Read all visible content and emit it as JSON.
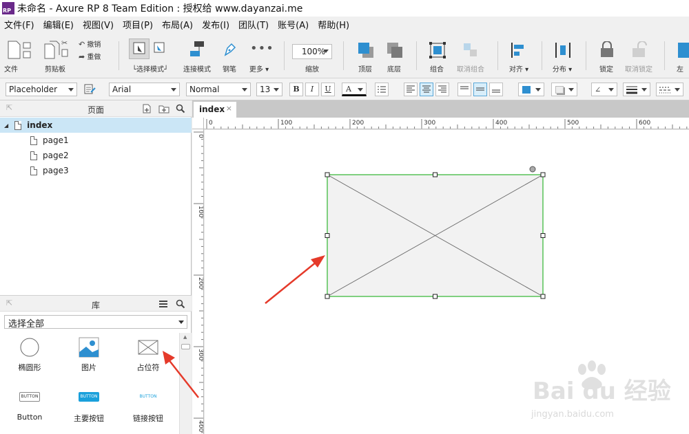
{
  "window": {
    "app_badge": "RP",
    "title": "未命名 - Axure RP 8 Team Edition : 授权给 www.dayanzai.me"
  },
  "menu": [
    "文件(F)",
    "编辑(E)",
    "视图(V)",
    "项目(P)",
    "布局(A)",
    "发布(I)",
    "团队(T)",
    "账号(A)",
    "帮助(H)"
  ],
  "toolbar": {
    "file": "文件",
    "clipboard": "剪贴板",
    "undo": "撤销",
    "redo": "重做",
    "select_mode": "└选择模式┘",
    "connect_mode": "连接模式",
    "pen": "钢笔",
    "more": "更多 ▾",
    "zoom_value": "100%",
    "zoom_label": "缩放",
    "top": "顶层",
    "bottom": "底层",
    "group": "组合",
    "ungroup": "取消组合",
    "align": "对齐 ▾",
    "distribute": "分布 ▾",
    "lock": "锁定",
    "unlock": "取消锁定",
    "left": "左"
  },
  "format": {
    "style": "Placeholder",
    "font": "Arial",
    "weight": "Normal",
    "size": "13",
    "bold": "B",
    "italic": "I",
    "underline": "U",
    "font_color": "A"
  },
  "pages_panel": {
    "title": "页面",
    "root": "index",
    "children": [
      "page1",
      "page2",
      "page3"
    ]
  },
  "library_panel": {
    "title": "库",
    "select": "选择全部",
    "items": [
      {
        "label": "椭圆形"
      },
      {
        "label": "图片"
      },
      {
        "label": "占位符"
      },
      {
        "label": "Button",
        "preview": "BUTTON"
      },
      {
        "label": "主要按钮",
        "preview": "BUTTON"
      },
      {
        "label": "链接按钮",
        "preview": "BUTTON"
      }
    ]
  },
  "tab": {
    "label": "index",
    "close": "×"
  },
  "ruler": {
    "h_labels": [
      "0",
      "100",
      "200",
      "300",
      "400",
      "500",
      "600"
    ],
    "v_labels": [
      "0",
      "100",
      "200",
      "300",
      "400"
    ]
  },
  "watermark": {
    "brand": "Bai du 经验",
    "url": "jingyan.baidu.com"
  },
  "colors": {
    "selection": "#2fb52f",
    "page_selected": "#cbe6f6",
    "arrow": "#e53a2a",
    "accent": "#2e8fd0"
  }
}
